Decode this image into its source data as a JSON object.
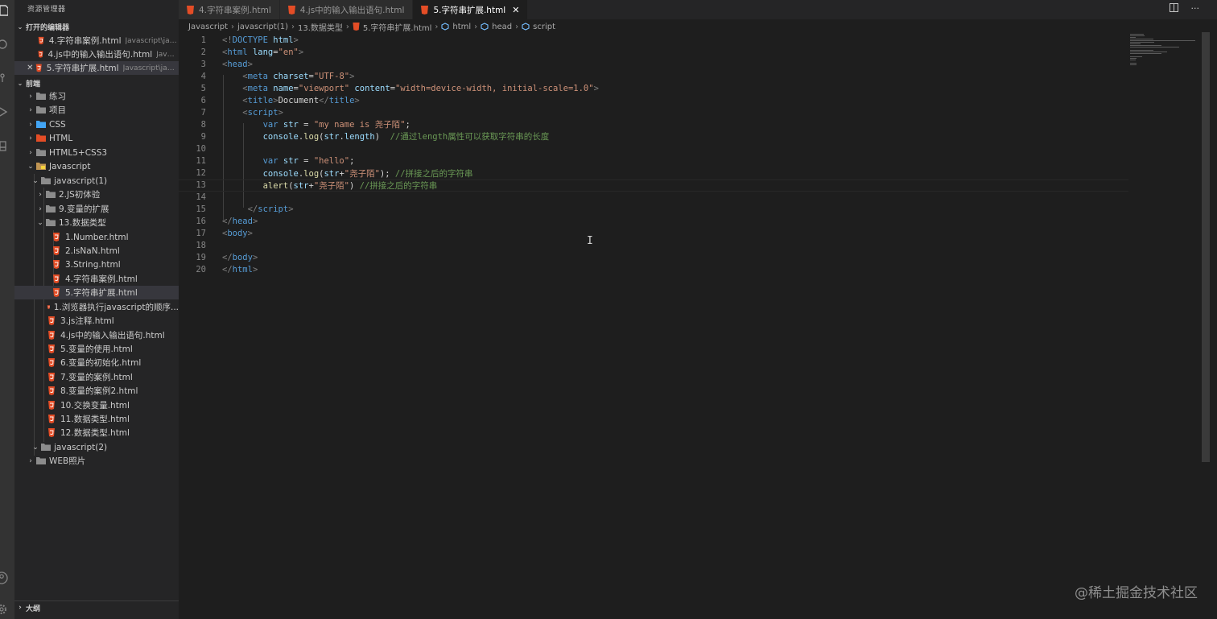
{
  "sidebar": {
    "title": "资源管理器",
    "open_editors_header": "打开的编辑器",
    "open_editors": [
      {
        "label": "4.字符串案例.html",
        "desc": "Javascript\\javas..."
      },
      {
        "label": "4.js中的输入输出语句.html",
        "desc": "Javasc..."
      },
      {
        "label": "5.字符串扩展.html",
        "desc": "Javascript\\javas..."
      }
    ],
    "workspace_header": "前端",
    "tree": [
      {
        "label": "练习"
      },
      {
        "label": "项目"
      },
      {
        "label": "CSS"
      },
      {
        "label": "HTML"
      },
      {
        "label": "HTML5+CSS3"
      },
      {
        "label": "Javascript"
      },
      {
        "label": "javascript(1)"
      },
      {
        "label": "2.JS初体验"
      },
      {
        "label": "9.变量的扩展"
      },
      {
        "label": "13.数据类型"
      },
      {
        "label": "1.Number.html"
      },
      {
        "label": "2.isNaN.html"
      },
      {
        "label": "3.String.html"
      },
      {
        "label": "4.字符串案例.html"
      },
      {
        "label": "5.字符串扩展.html"
      },
      {
        "label": "1.浏览器执行javascript的顺序..."
      },
      {
        "label": "3.js注释.html"
      },
      {
        "label": "4.js中的输入输出语句.html"
      },
      {
        "label": "5.变量的使用.html"
      },
      {
        "label": "6.变量的初始化.html"
      },
      {
        "label": "7.变量的案例.html"
      },
      {
        "label": "8.变量的案例2.html"
      },
      {
        "label": "10.交换变量.html"
      },
      {
        "label": "11.数据类型.html"
      },
      {
        "label": "12.数据类型.html"
      },
      {
        "label": "javascript(2)"
      },
      {
        "label": "WEB照片"
      }
    ],
    "outline_header": "大纲"
  },
  "tabs": [
    {
      "label": "4.字符串案例.html"
    },
    {
      "label": "4.js中的输入输出语句.html"
    },
    {
      "label": "5.字符串扩展.html"
    }
  ],
  "breadcrumb": [
    "Javascript",
    "javascript(1)",
    "13.数据类型",
    "5.字符串扩展.html",
    "html",
    "head",
    "script"
  ],
  "editor": {
    "line_numbers": [
      "1",
      "2",
      "3",
      "4",
      "5",
      "6",
      "7",
      "8",
      "9",
      "10",
      "11",
      "12",
      "13",
      "14",
      "15",
      "16",
      "17",
      "18",
      "19",
      "20"
    ],
    "lines": [
      [
        [
          "b",
          "<!"
        ],
        [
          "t",
          "DOCTYPE"
        ],
        [
          "p",
          " "
        ],
        [
          "a",
          "html"
        ],
        [
          "b",
          ">"
        ]
      ],
      [
        [
          "b",
          "<"
        ],
        [
          "t",
          "html"
        ],
        [
          "p",
          " "
        ],
        [
          "a",
          "lang"
        ],
        [
          "p",
          "="
        ],
        [
          "s",
          "\"en\""
        ],
        [
          "b",
          ">"
        ]
      ],
      [
        [
          "b",
          "<"
        ],
        [
          "t",
          "head"
        ],
        [
          "b",
          ">"
        ]
      ],
      [
        [
          "p",
          "    "
        ],
        [
          "b",
          "<"
        ],
        [
          "t",
          "meta"
        ],
        [
          "p",
          " "
        ],
        [
          "a",
          "charset"
        ],
        [
          "p",
          "="
        ],
        [
          "s",
          "\"UTF-8\""
        ],
        [
          "b",
          ">"
        ]
      ],
      [
        [
          "p",
          "    "
        ],
        [
          "b",
          "<"
        ],
        [
          "t",
          "meta"
        ],
        [
          "p",
          " "
        ],
        [
          "a",
          "name"
        ],
        [
          "p",
          "="
        ],
        [
          "s",
          "\"viewport\""
        ],
        [
          "p",
          " "
        ],
        [
          "a",
          "content"
        ],
        [
          "p",
          "="
        ],
        [
          "s",
          "\"width=device-width, initial-scale=1.0\""
        ],
        [
          "b",
          ">"
        ]
      ],
      [
        [
          "p",
          "    "
        ],
        [
          "b",
          "<"
        ],
        [
          "t",
          "title"
        ],
        [
          "b",
          ">"
        ],
        [
          "p",
          "Document"
        ],
        [
          "b",
          "</"
        ],
        [
          "t",
          "title"
        ],
        [
          "b",
          ">"
        ]
      ],
      [
        [
          "p",
          "    "
        ],
        [
          "b",
          "<"
        ],
        [
          "t",
          "script"
        ],
        [
          "b",
          ">"
        ]
      ],
      [
        [
          "p",
          "        "
        ],
        [
          "k",
          "var"
        ],
        [
          "p",
          " "
        ],
        [
          "v",
          "str"
        ],
        [
          "p",
          " = "
        ],
        [
          "s",
          "\"my name is 尧子陌\""
        ],
        [
          "p",
          ";"
        ]
      ],
      [
        [
          "p",
          "        "
        ],
        [
          "v",
          "console"
        ],
        [
          "p",
          "."
        ],
        [
          "f",
          "log"
        ],
        [
          "p",
          "("
        ],
        [
          "v",
          "str"
        ],
        [
          "p",
          "."
        ],
        [
          "v",
          "length"
        ],
        [
          "p",
          ")  "
        ],
        [
          "c",
          "//通过length属性可以获取字符串的长度"
        ]
      ],
      [],
      [
        [
          "p",
          "        "
        ],
        [
          "k",
          "var"
        ],
        [
          "p",
          " "
        ],
        [
          "v",
          "str"
        ],
        [
          "p",
          " = "
        ],
        [
          "s",
          "\"hello\""
        ],
        [
          "p",
          ";"
        ]
      ],
      [
        [
          "p",
          "        "
        ],
        [
          "v",
          "console"
        ],
        [
          "p",
          "."
        ],
        [
          "f",
          "log"
        ],
        [
          "p",
          "("
        ],
        [
          "v",
          "str"
        ],
        [
          "p",
          "+"
        ],
        [
          "s",
          "\"尧子陌\""
        ],
        [
          "p",
          "); "
        ],
        [
          "c",
          "//拼接之后的字符串"
        ]
      ],
      [
        [
          "p",
          "        "
        ],
        [
          "f",
          "alert"
        ],
        [
          "p",
          "("
        ],
        [
          "v",
          "str"
        ],
        [
          "p",
          "+"
        ],
        [
          "s",
          "\"尧子陌\""
        ],
        [
          "p",
          ") "
        ],
        [
          "c",
          "//拼接之后的字符串"
        ]
      ],
      [],
      [
        [
          "p",
          "     "
        ],
        [
          "b",
          "</"
        ],
        [
          "t",
          "script"
        ],
        [
          "b",
          ">"
        ]
      ],
      [
        [
          "b",
          "</"
        ],
        [
          "t",
          "head"
        ],
        [
          "b",
          ">"
        ]
      ],
      [
        [
          "b",
          "<"
        ],
        [
          "t",
          "body"
        ],
        [
          "b",
          ">"
        ]
      ],
      [],
      [
        [
          "b",
          "</"
        ],
        [
          "t",
          "body"
        ],
        [
          "b",
          ">"
        ]
      ],
      [
        [
          "b",
          "</"
        ],
        [
          "t",
          "html"
        ],
        [
          "b",
          ">"
        ]
      ]
    ]
  },
  "watermark": "@稀土掘金技术社区",
  "colors": {
    "editor_bg": "#1e1e1e",
    "sidebar_bg": "#252526",
    "html_icon": "#e44d26",
    "folder": "#c09553",
    "tag": "#569cd6",
    "string": "#ce9178",
    "comment": "#6a9955"
  }
}
